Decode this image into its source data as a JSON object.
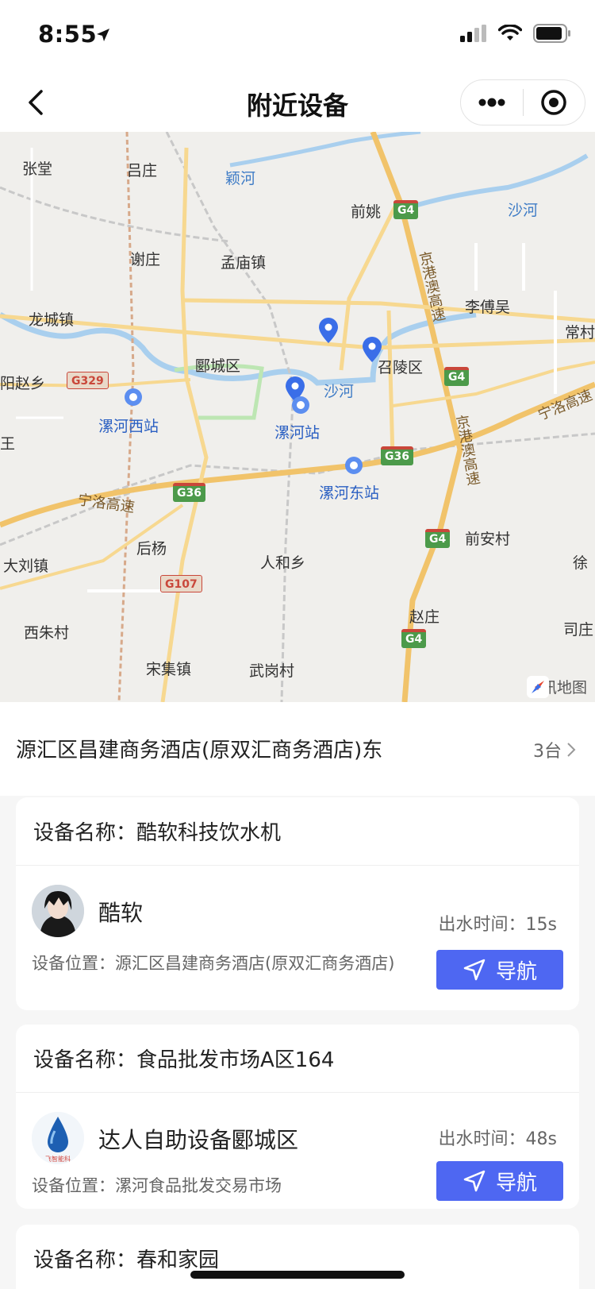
{
  "status_bar": {
    "time": "8:55",
    "icons": [
      "location-arrow-icon",
      "signal-icon",
      "wifi-icon",
      "battery-icon"
    ]
  },
  "nav": {
    "title": "附近设备",
    "back_icon": "chevron-left-icon",
    "more_icon": "more-dots-icon",
    "close_icon": "target-circle-icon"
  },
  "map": {
    "labels": {
      "zhangtang": "张堂",
      "lvzhuang": "吕庄",
      "yinghe": "颖河",
      "qianyao": "前姚",
      "shahe_ne": "沙河",
      "xiezhuang": "谢庄",
      "mengmiao": "孟庙镇",
      "jinggang": "京港澳高速",
      "lichuanwu": "李傅吴",
      "changcun": "常村",
      "longcheng": "龙城镇",
      "yancheng": "郾城区",
      "zhaoling": "召陵区",
      "shahe_mid": "沙河",
      "yangzhao": "阳赵乡",
      "wang": "王",
      "luohe_west": "漯河西站",
      "luohe_station": "漯河站",
      "ningluo_e": "宁洛高速",
      "jinggang2": "京港澳高速",
      "luohe_east": "漯河东站",
      "ningluo_w": "宁洛高速",
      "qianan": "前安村",
      "houyang": "后杨",
      "dalie": "大刘镇",
      "renhe": "人和乡",
      "xu": "徐",
      "zhaozhuang": "赵庄",
      "xizhu": "西朱村",
      "sizhuang": "司庄",
      "songji": "宋集镇",
      "wugang": "武岗村"
    },
    "badges": {
      "g4_a": "G4",
      "g4_b": "G4",
      "g4_c": "G4",
      "g4_d": "G4",
      "g329": "G329",
      "g36_a": "G36",
      "g36_b": "G36",
      "g107": "G107"
    },
    "logo": "腾讯地图"
  },
  "location": {
    "name": "源汇区昌建商务酒店(原双汇商务酒店)东",
    "count": "3台"
  },
  "devices": [
    {
      "name_label": "设备名称：酷软科技饮水机",
      "owner": "酷软",
      "water_time": "出水时间：15s",
      "address": "设备位置：源汇区昌建商务酒店(原双汇商务酒店)",
      "nav_label": "导航"
    },
    {
      "name_label": "设备名称：食品批发市场A区164",
      "owner": "达人自助设备郾城区",
      "water_time": "出水时间：48s",
      "address": "设备位置：漯河食品批发交易市场",
      "nav_label": "导航",
      "avatar_text": "飞智能科"
    },
    {
      "name_label": "设备名称：春和家园"
    }
  ],
  "colors": {
    "accent": "#4e67f2",
    "pin": "#3a6ee8",
    "road": "#f1c36a",
    "water": "#a9cfee"
  }
}
